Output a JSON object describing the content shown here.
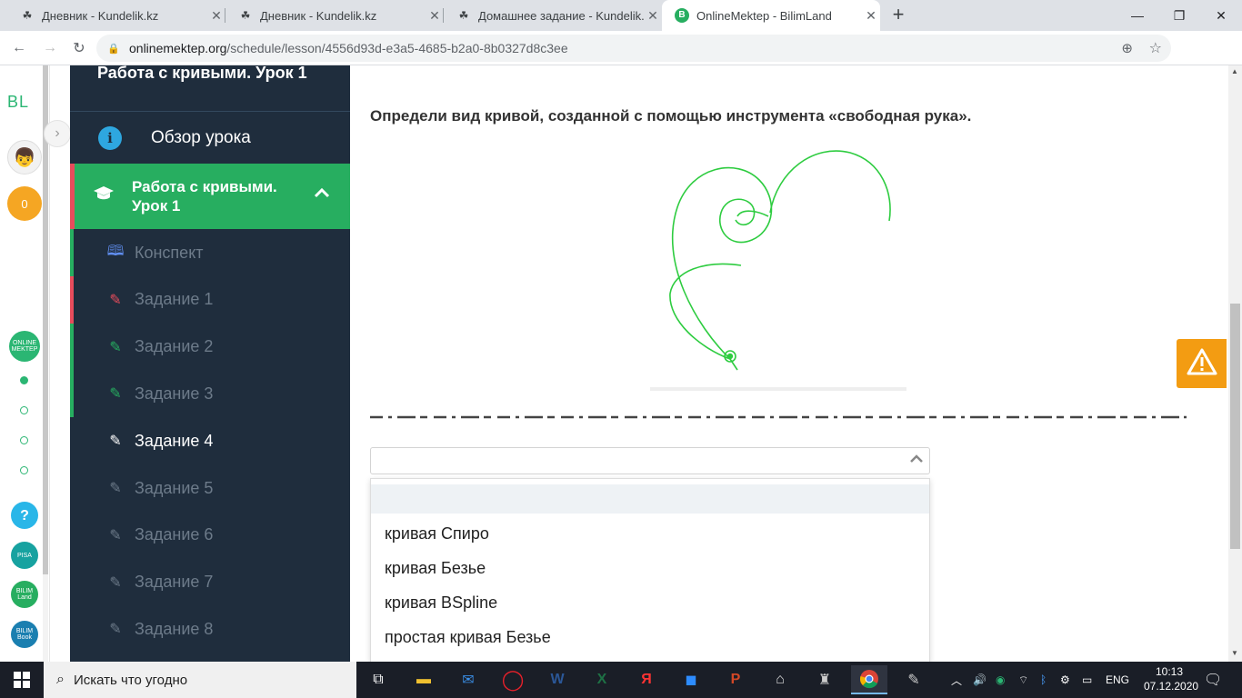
{
  "browser": {
    "tabs": [
      {
        "title": "Дневник - Kundelik.kz",
        "favicon": "kundelik-icon"
      },
      {
        "title": "Дневник - Kundelik.kz",
        "favicon": "kundelik-icon"
      },
      {
        "title": "Домашнее задание - Kundelik.kz",
        "favicon": "kundelik-icon"
      },
      {
        "title": "OnlineMektep - BilimLand",
        "favicon": "bilimland-icon",
        "active": true
      }
    ],
    "url_host": "onlinemektep.org",
    "url_path": "/schedule/lesson/4556d93d-e3a5-4685-b2a0-8b0327d8c3ee"
  },
  "leftrail": {
    "brand": "BL",
    "coins": "0",
    "help": "?",
    "buttons": [
      "PISA",
      "BILIM Land",
      "BILIM Book"
    ],
    "online_mektep": "ONLINE MEKTEP"
  },
  "sidebar": {
    "lesson_title": "Работа с кривыми. Урок 1",
    "overview": "Обзор урока",
    "active_section": "Работа с кривыми. Урок 1",
    "items": [
      {
        "label": "Конспект",
        "icon": "book-icon",
        "state": "done"
      },
      {
        "label": "Задание 1",
        "icon": "edit-icon",
        "state": "wrong"
      },
      {
        "label": "Задание 2",
        "icon": "edit-icon",
        "state": "done"
      },
      {
        "label": "Задание 3",
        "icon": "edit-icon",
        "state": "done"
      },
      {
        "label": "Задание 4",
        "icon": "edit-icon",
        "state": "current"
      },
      {
        "label": "Задание 5",
        "icon": "edit-icon",
        "state": "pending"
      },
      {
        "label": "Задание 6",
        "icon": "edit-icon",
        "state": "pending"
      },
      {
        "label": "Задание 7",
        "icon": "edit-icon",
        "state": "pending"
      },
      {
        "label": "Задание 8",
        "icon": "edit-icon",
        "state": "pending"
      }
    ]
  },
  "task": {
    "question": "Определи вид кривой, созданной с помощью инструмента «свободная рука».",
    "select_value": "",
    "options": [
      "",
      "кривая Спиро",
      "кривая Безье",
      "кривая BSpline",
      "простая кривая Безье"
    ]
  },
  "taskbar": {
    "search_placeholder": "Искать что угодно",
    "language": "ENG",
    "time": "10:13",
    "date": "07.12.2020"
  },
  "colors": {
    "sidebar_bg": "#1f2d3d",
    "active_green": "#27ae60",
    "curve_green": "#2ecc40",
    "warning_orange": "#f39c12",
    "wrong_red": "#e74c5c"
  }
}
